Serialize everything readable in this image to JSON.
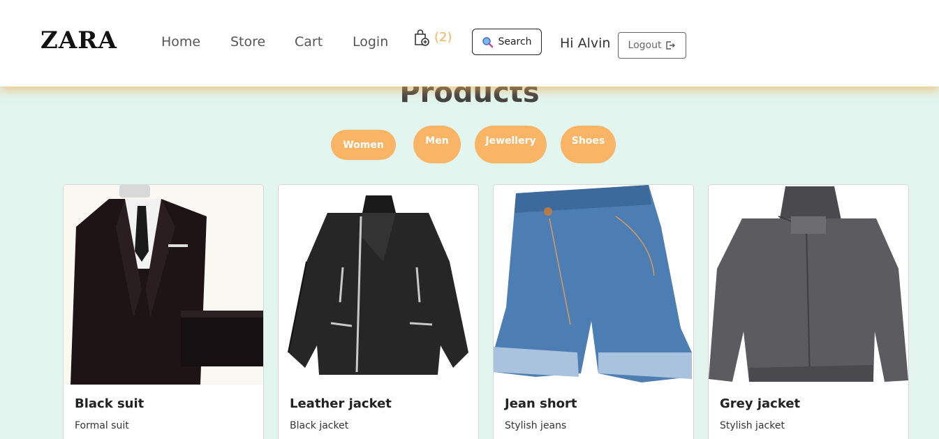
{
  "navbar": {
    "brand": "ZARA",
    "links": [
      "Home",
      "Store",
      "Cart",
      "Login"
    ],
    "cart_count": "(2)",
    "cart_icon": "shopping-bag-plus-icon",
    "search_label": "Search",
    "search_icon": "magnifier-icon",
    "greeting": "Hi Alvin",
    "logout_label": "Logout",
    "logout_icon": "box-arrow-right-icon"
  },
  "main": {
    "title": "Products",
    "categories": [
      "Women",
      "Men",
      "Jewellery",
      "Shoes"
    ]
  },
  "products": [
    {
      "title": "Black suit",
      "text": "Formal suit"
    },
    {
      "title": "Leather jacket",
      "text": "Black jacket"
    },
    {
      "title": "Jean short",
      "text": "Stylish jeans"
    },
    {
      "title": "Grey jacket",
      "text": "Stylish jacket"
    }
  ],
  "colors": {
    "accent": "#f9b466",
    "cart_count": "#f5b35c",
    "page_background": "#e2f5ef",
    "navbar_background": "#ffffff"
  }
}
